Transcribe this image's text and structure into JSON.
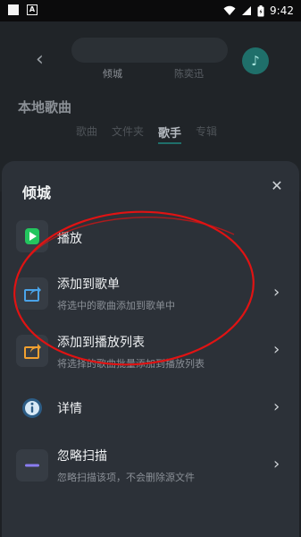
{
  "status_bar": {
    "time": "9:42"
  },
  "background": {
    "search_tab_left": "倾城",
    "search_tab_right": "陈奕迅",
    "section_title": "本地歌曲",
    "tabs": [
      "歌曲",
      "文件夹",
      "歌手",
      "专辑"
    ],
    "active_tab": "歌手"
  },
  "sheet": {
    "title": "倾城",
    "items": [
      {
        "title": "播放",
        "subtitle": "",
        "icon": "play-icon"
      },
      {
        "title": "添加到歌单",
        "subtitle": "将选中的歌曲添加到歌单中",
        "icon": "share-arrow-icon"
      },
      {
        "title": "添加到播放列表",
        "subtitle": "将选择的歌曲批量添加到播放列表",
        "icon": "add-to-playlist-icon"
      },
      {
        "title": "详情",
        "subtitle": "",
        "icon": "info-icon"
      },
      {
        "title": "忽略扫描",
        "subtitle": "忽略扫描该项，不会删除源文件",
        "icon": "minus-icon"
      }
    ]
  },
  "colors": {
    "accent_green": "#23c55e",
    "accent_orange": "#f0a030",
    "accent_blue": "#4aa3e8",
    "accent_purple": "#8a7cf0",
    "annotation_red": "#e01313"
  }
}
